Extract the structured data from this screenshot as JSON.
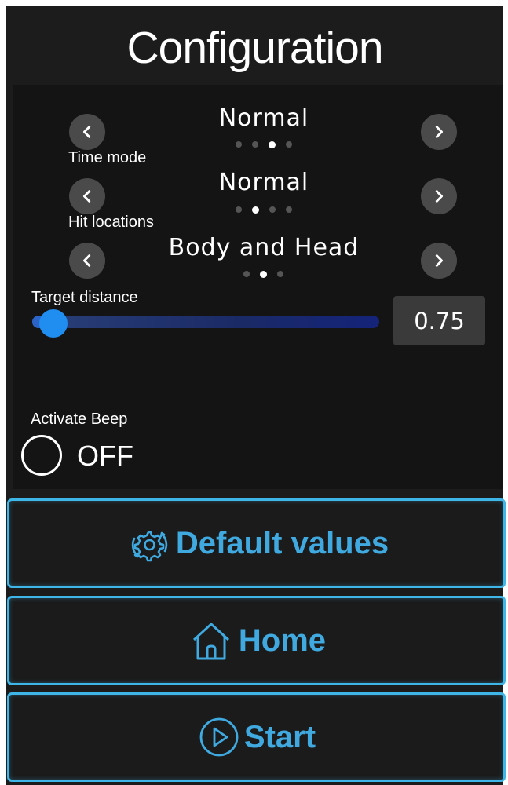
{
  "title": "Configuration",
  "selectors": [
    {
      "value": "Normal",
      "label": "Time mode",
      "dots": 4,
      "active_dot": 2
    },
    {
      "value": "Normal",
      "label": "Hit locations",
      "dots": 4,
      "active_dot": 1
    },
    {
      "value": "Body and Head",
      "label": "",
      "dots": 3,
      "active_dot": 1
    }
  ],
  "target_distance": {
    "label": "Target distance",
    "value": 0.75,
    "display": "0.75"
  },
  "beep": {
    "label": "Activate Beep",
    "state": "OFF"
  },
  "buttons": {
    "defaults": "Default values",
    "home": "Home",
    "start": "Start"
  },
  "colors": {
    "accent": "#3fb6e8",
    "button_text": "#3fa9e0",
    "slider_thumb": "#1f8ef0"
  },
  "icons": {
    "prev": "chevron-left-icon",
    "next": "chevron-right-icon",
    "defaults": "gear-reset-icon",
    "home": "home-icon",
    "start": "play-circle-icon"
  }
}
